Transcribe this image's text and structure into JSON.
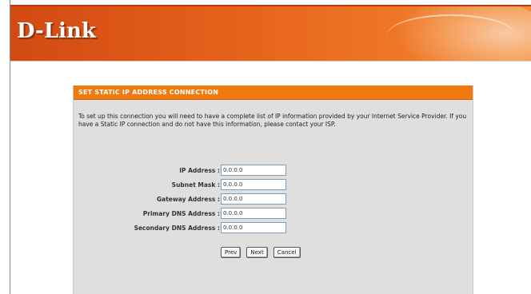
{
  "header": {
    "logo_text": "D-Link",
    "accent_color": "#e2601a"
  },
  "panel": {
    "title": "SET STATIC IP ADDRESS CONNECTION",
    "intro": "To set up this connection you will need to have a complete list of IP information provided by your Internet Service Provider. If you have a Static IP connection and do not have this information, please contact your ISP.",
    "header_color": "#f07a10"
  },
  "form": {
    "fields": [
      {
        "label": "IP Address :",
        "value": "0.0.0.0"
      },
      {
        "label": "Subnet Mask :",
        "value": "0.0.0.0"
      },
      {
        "label": "Gateway Address :",
        "value": "0.0.0.0"
      },
      {
        "label": "Primary DNS Address :",
        "value": "0.0.0.0"
      },
      {
        "label": "Secondary DNS Address :",
        "value": "0.0.0.0"
      }
    ]
  },
  "buttons": {
    "prev": "Prev",
    "next": "Next",
    "cancel": "Cancel"
  }
}
